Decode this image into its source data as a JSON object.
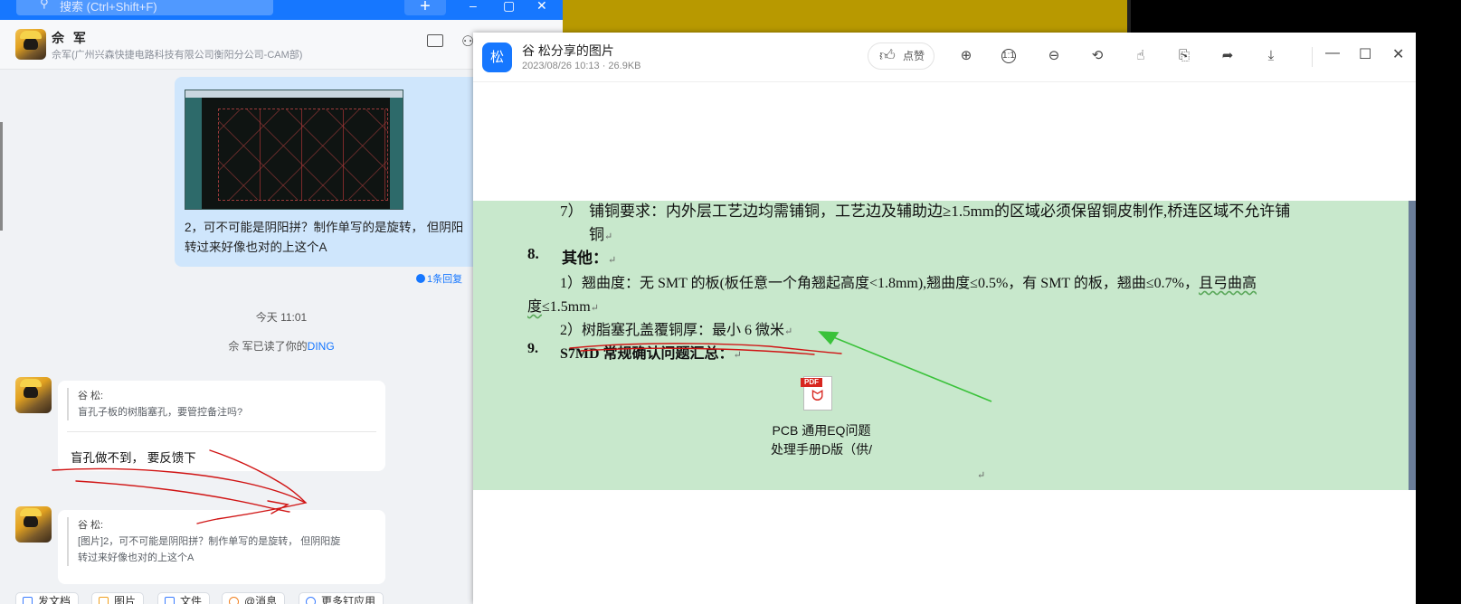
{
  "chat": {
    "search_placeholder": "搜索 (Ctrl+Shift+F)",
    "plus_label": "+",
    "win_min": "–",
    "win_max": "▢",
    "win_close": "✕",
    "contact_name": "佘 军",
    "contact_subtitle": "佘军(广州兴森快捷电路科技有限公司衡阳分公司-CAM部)",
    "sent_message": "2，可不可能是阴阳拼？制作单写的是旋转， 但阴阳\n转过来好像也对的上这个A",
    "reply_count": "1条回复",
    "time_separator": "今天 11:01",
    "ding_prefix": "佘 军已读了你的",
    "ding_link": "DING",
    "msg1_quote_name": "谷 松:",
    "msg1_quote_text": "盲孔子板的树脂塞孔，要管控备注吗?",
    "msg1_reply": "盲孔做不到， 要反馈下",
    "msg2_quote_name": "谷 松:",
    "msg2_quote_line1": "[图片]2，可不可能是阴阳拼？制作单写的是旋转， 但阴阳旋",
    "msg2_quote_line2": "转过来好像也对的上这个A",
    "tools": [
      "发文档",
      "图片",
      "文件",
      "@消息",
      "更多钉应用"
    ]
  },
  "viewer": {
    "avatar_char": "松",
    "title": "谷 松分享的图片",
    "meta": "2023/08/26 10:13 · 26.9KB",
    "like_label": "点赞",
    "win_min": "—",
    "win_max": "☐",
    "win_close": "✕"
  },
  "document": {
    "item7_num": "7）",
    "item7_line1": "铺铜要求：内外层工艺边均需铺铜，工艺边及辅助边≥1.5mm的区域必须保留铜皮制作,桥连区域不允许铺",
    "item7_line2": "铜",
    "item8_num": "8.",
    "item8_title": "其他：",
    "item8_1_prefix": "1）翘曲度：无 SMT 的板(板任意一个角翘起高度<1.8mm),翘曲度≤0.5%，有 SMT 的板，翘曲≤0.7%，",
    "item8_1_wavy": "且弓曲高",
    "item8_1_line2_wavy": "度",
    "item8_1_line2_rest": "≤1.5mm",
    "item8_2": "2）树脂塞孔盖覆铜厚：最小 6 微米",
    "item9_num": "9.",
    "item9_title": "S7MD 常规确认问题汇总：",
    "pdf_tag": "PDF",
    "pdf_caption_line1": "PCB 通用EQ问题",
    "pdf_caption_line2": "处理手册D版（供/",
    "return_mark": "↵"
  },
  "colors": {
    "accent": "#1677ff",
    "doc_background": "#c8e8cc",
    "annotation_red": "#d01414",
    "annotation_green": "#3ac23a"
  }
}
